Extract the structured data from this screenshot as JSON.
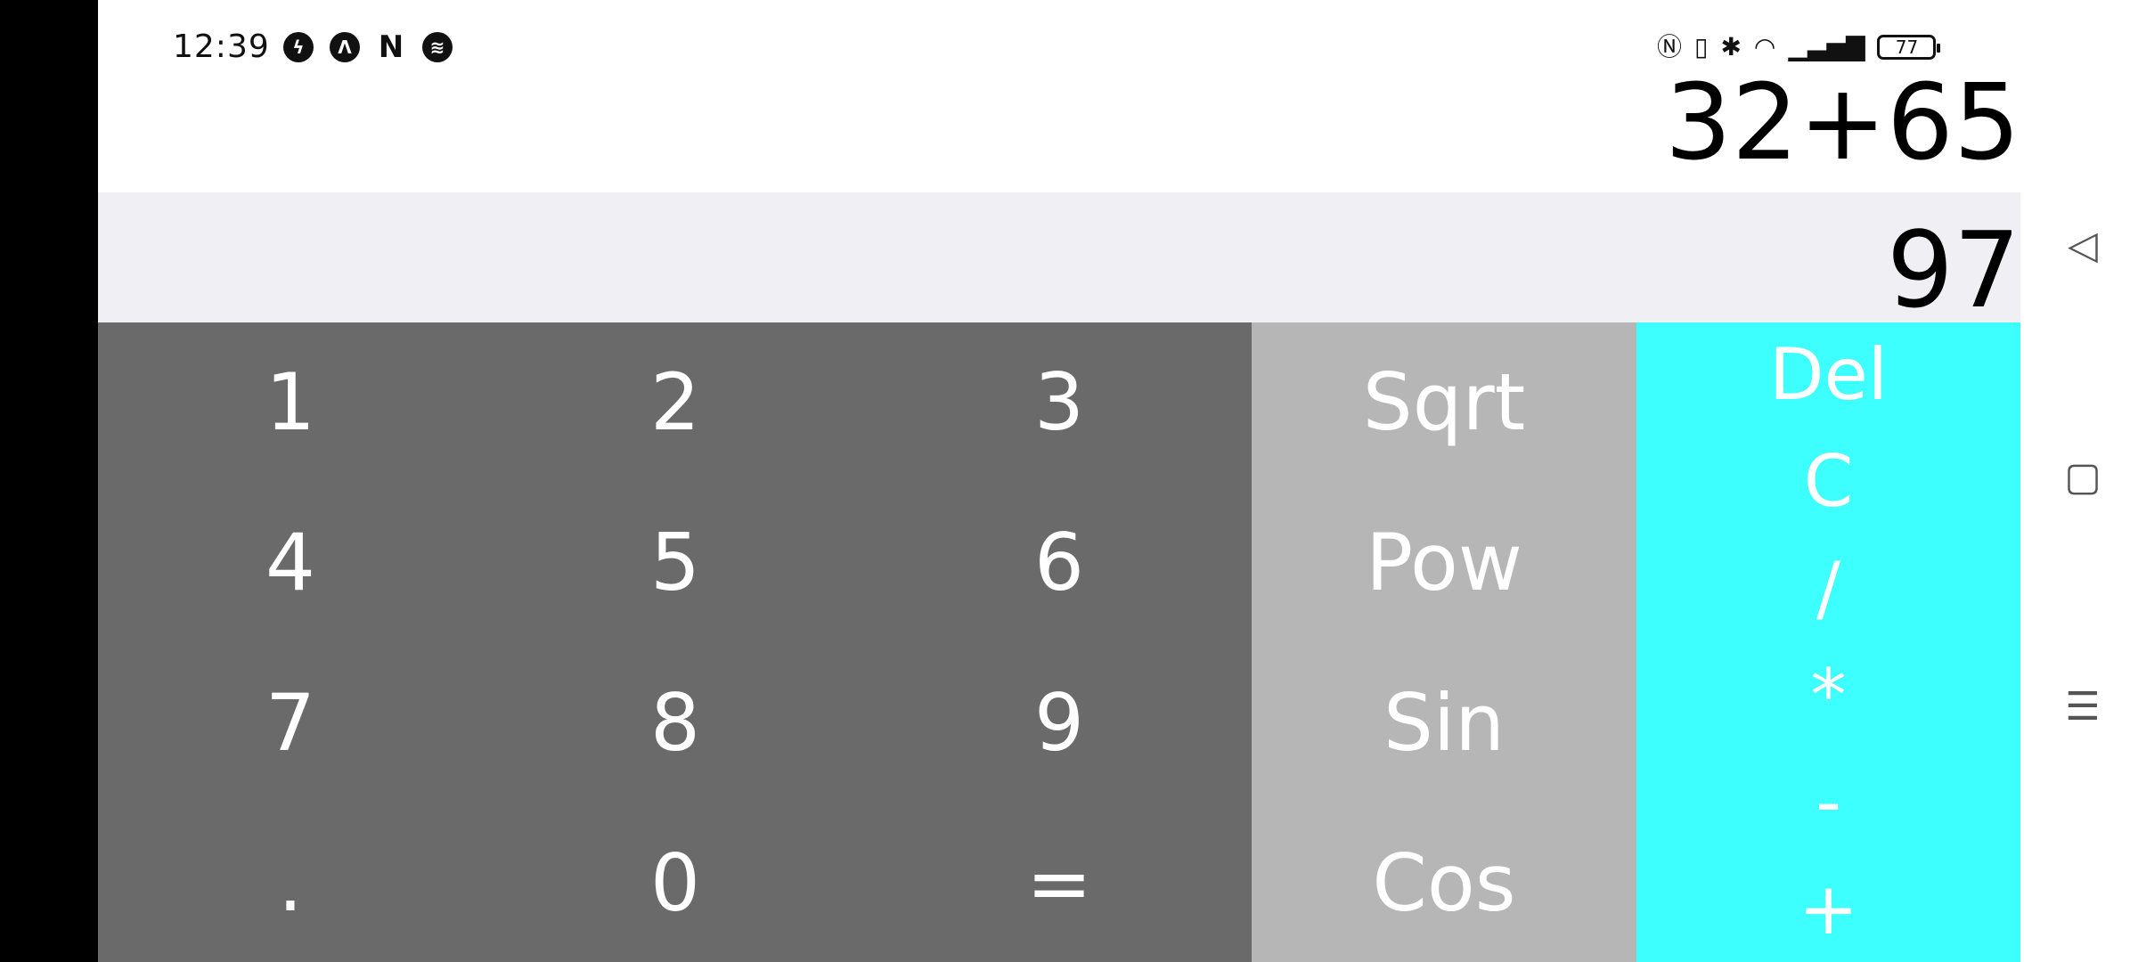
{
  "status_bar": {
    "time": "12:39",
    "notification_icons": [
      "messenger-icon",
      "app-a-icon",
      "netflix-icon",
      "spotify-icon"
    ],
    "system_icons": [
      "nfc-icon",
      "vibrate-icon",
      "bluetooth-icon",
      "wifi-icon",
      "signal-icon"
    ],
    "battery": "77"
  },
  "display": {
    "expression": "32+65",
    "result": "97"
  },
  "keypad": {
    "digits": [
      [
        "1",
        "2",
        "3"
      ],
      [
        "4",
        "5",
        "6"
      ],
      [
        "7",
        "8",
        "9"
      ],
      [
        ".",
        "0",
        "="
      ]
    ],
    "functions": [
      "Sqrt",
      "Pow",
      "Sin",
      "Cos"
    ],
    "operators": [
      "Del",
      "C",
      "/",
      "*",
      "-",
      "+"
    ]
  },
  "colors": {
    "digit_pad": "#6a6a6a",
    "function_pad": "#b6b6b6",
    "operator_pad": "#3dfffd",
    "result_bar": "#f0f0f4"
  },
  "nav_bar": {
    "icons": [
      "back-icon",
      "recents-icon",
      "menu-icon"
    ]
  }
}
